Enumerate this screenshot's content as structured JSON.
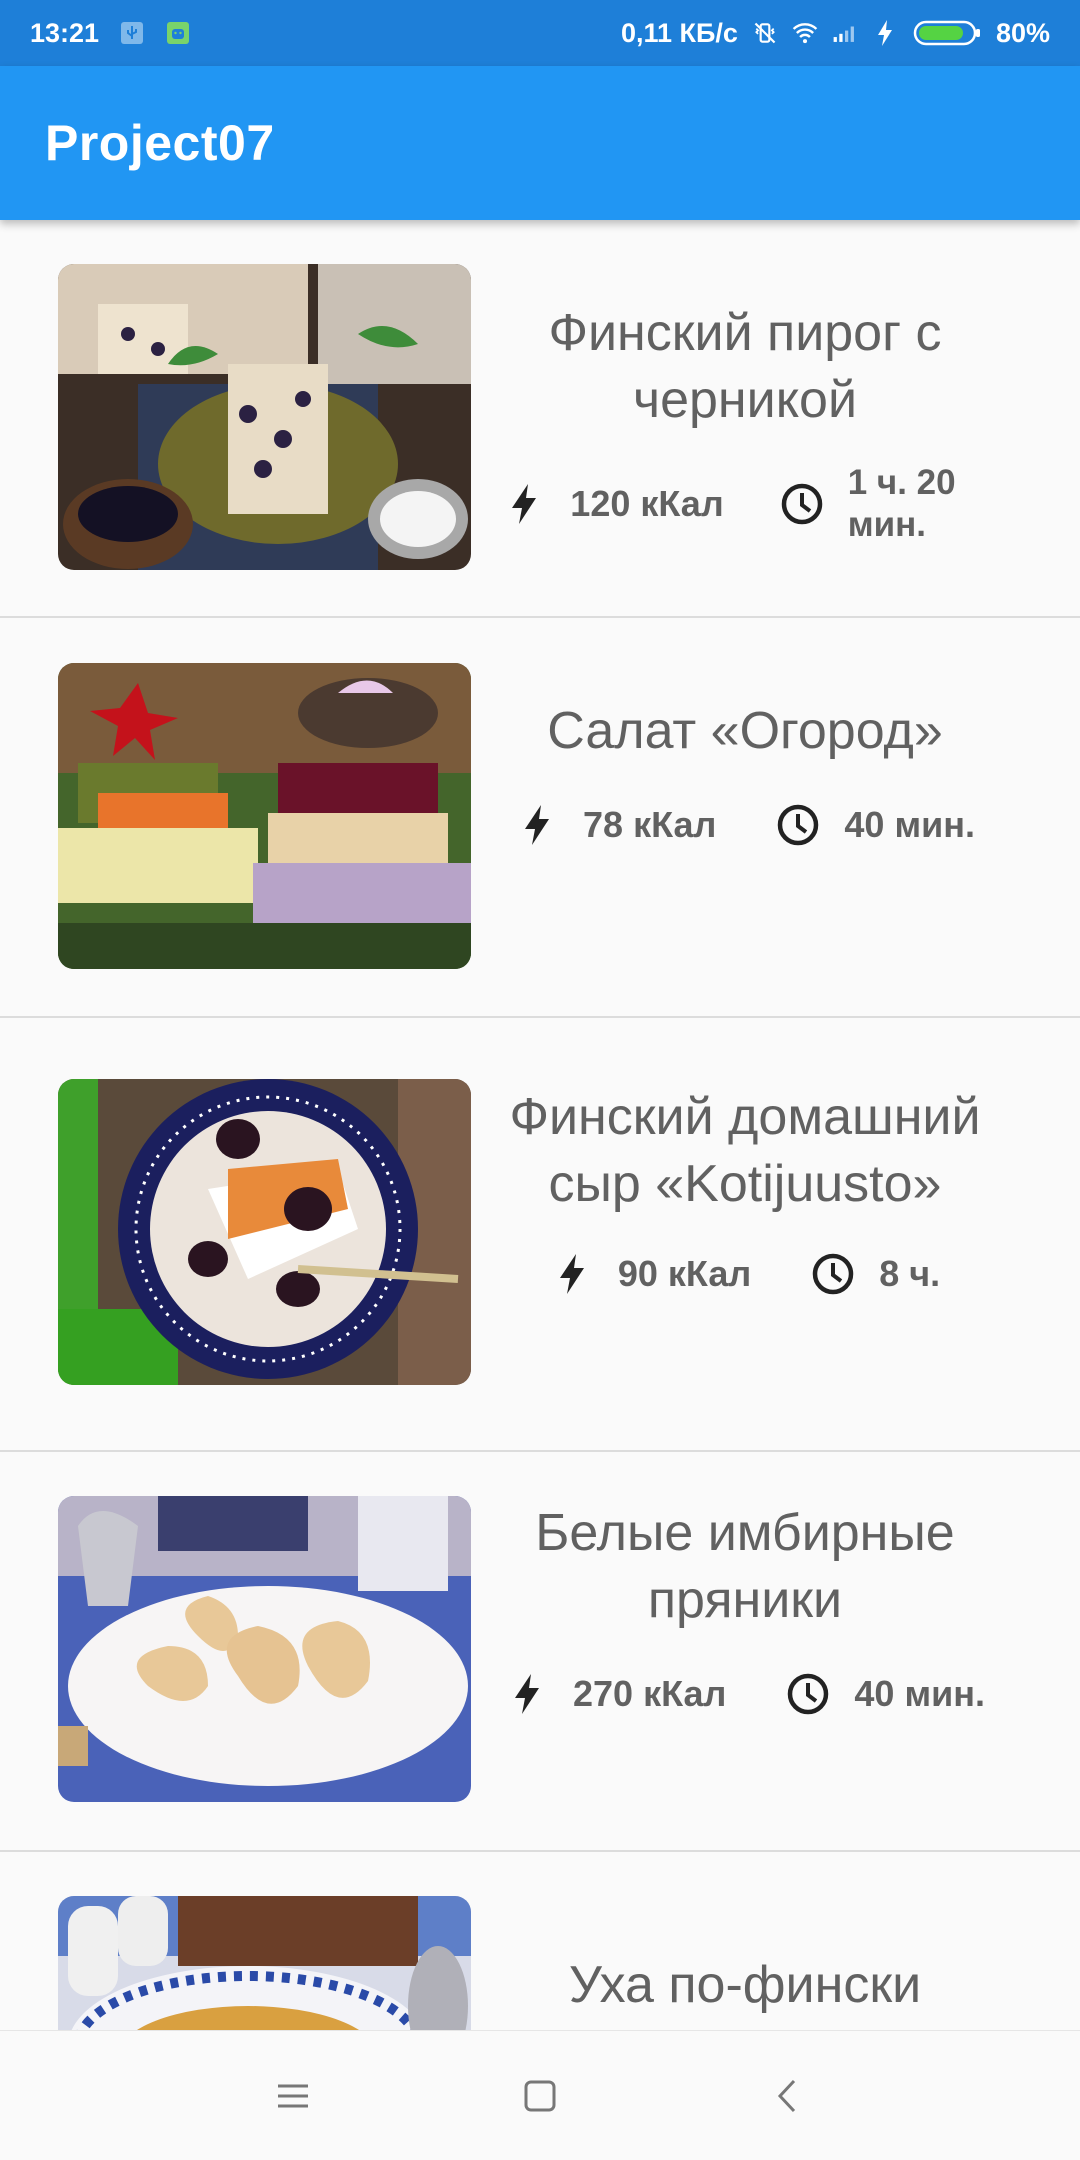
{
  "status_bar": {
    "time": "13:21",
    "network_speed": "0,11 КБ/с",
    "battery": "80%",
    "icons": [
      "usb-icon",
      "android-debug-icon",
      "vibrate-icon",
      "wifi-icon",
      "signal-icon",
      "charging-icon",
      "battery-icon"
    ]
  },
  "app_bar": {
    "title": "Project07"
  },
  "recipes": [
    {
      "title": "Финский пирог с черникой",
      "calories": "120 кКал",
      "time": "1 ч. 20 мин.",
      "image": "blueberry-pie-photo"
    },
    {
      "title": "Салат «Огород»",
      "calories": "78 кКал",
      "time": "40 мин.",
      "image": "vegetable-salad-photo"
    },
    {
      "title": "Финский домашний сыр «Kotijuusto»",
      "calories": "90 кКал",
      "time": "8 ч.",
      "image": "homemade-cheese-photo"
    },
    {
      "title": "Белые имбирные пряники",
      "calories": "270 кКал",
      "time": "40 мин.",
      "image": "ginger-cookies-photo"
    },
    {
      "title": "Уха по-фински",
      "calories": "",
      "time": "",
      "image": "fish-soup-photo"
    }
  ],
  "nav_bar": {
    "icons": [
      "menu-icon",
      "home-square-icon",
      "back-chevron-icon"
    ]
  }
}
